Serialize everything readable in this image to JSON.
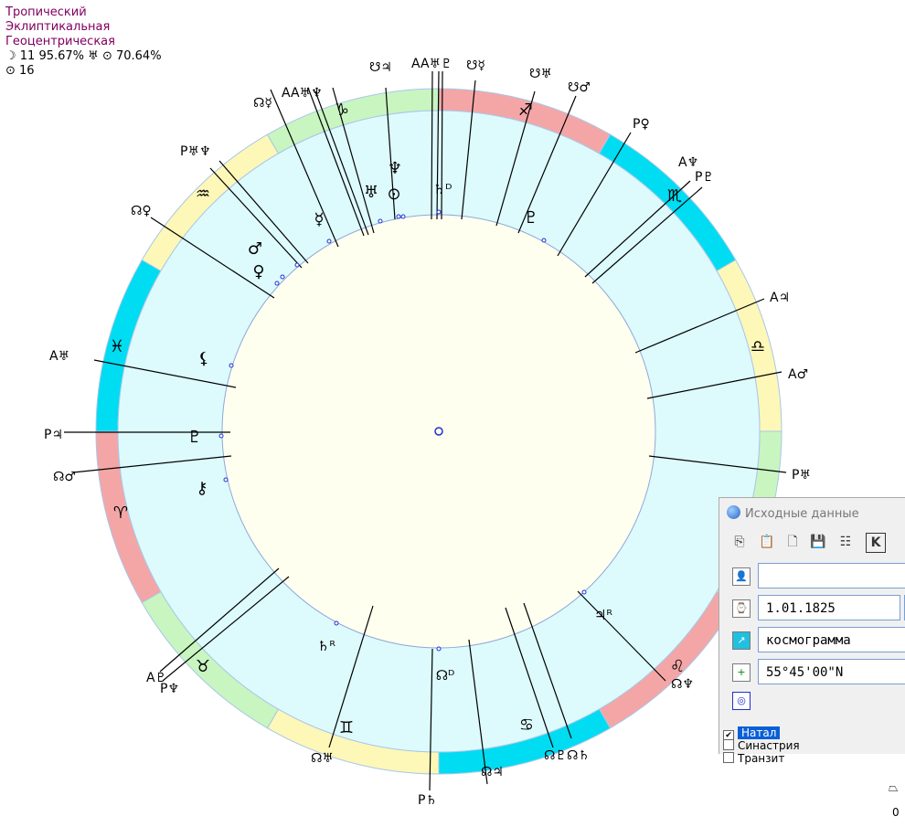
{
  "header": {
    "lines": [
      "Тропический",
      "Эклиптикальная",
      "Геоцентрическая"
    ],
    "moon_stat": "☽ 11 95.67% ♅ ⊙ 70.64%",
    "sun_stat": "⊙ 16"
  },
  "colors": {
    "ring_red": "#f4a6a6",
    "ring_cyan": "#00dcf2",
    "ring_yellow": "#fdf7b8",
    "ring_green": "#c8f5c0",
    "inner_ring": "#ddfafd",
    "center": "#fffff0"
  },
  "zodiac_glyphs": [
    "♑",
    "♐",
    "♏",
    "♎",
    "♍",
    "♌",
    "♋",
    "♊",
    "♉",
    "♈",
    "♓",
    "♒"
  ],
  "outer_labels": [
    "☊☿",
    "AA♅♆",
    "☋♃",
    "AA♅♇",
    "☋☿",
    "☋♅",
    "☋♂",
    "P♀",
    "A♆",
    "P♇",
    "A♃",
    "A♂",
    "P♅",
    "☊♆",
    "☊♇☊♄",
    "☊♃",
    "P♄",
    "☊♅",
    "A♇",
    "P♆",
    "☊♂",
    "P♃",
    "A♅",
    "☊♀",
    "P♅♆"
  ],
  "planet_glyphs": [
    "☿",
    "♂",
    "♀",
    "♅",
    "⊙",
    "♆",
    "♄ᴰ",
    "♇",
    "♃ᴿ",
    "♄ᴿ",
    "☊ᴰ",
    "⚸",
    "♇",
    "⚷"
  ],
  "panel": {
    "title": "Исходные данные",
    "toolbar": [
      "⎘",
      "📋",
      "🗋",
      "💾",
      "☷",
      "K"
    ],
    "fields": {
      "name": "",
      "date": "1.01.1825",
      "city": "космограмма",
      "latitude": "55°45'00\"N"
    },
    "checks": [
      {
        "label": "Натал",
        "checked": true
      },
      {
        "label": "Синастрия",
        "checked": false
      },
      {
        "label": "Транзит",
        "checked": false
      }
    ]
  },
  "bottom_glyph": "⏢",
  "bottom_number": "0"
}
